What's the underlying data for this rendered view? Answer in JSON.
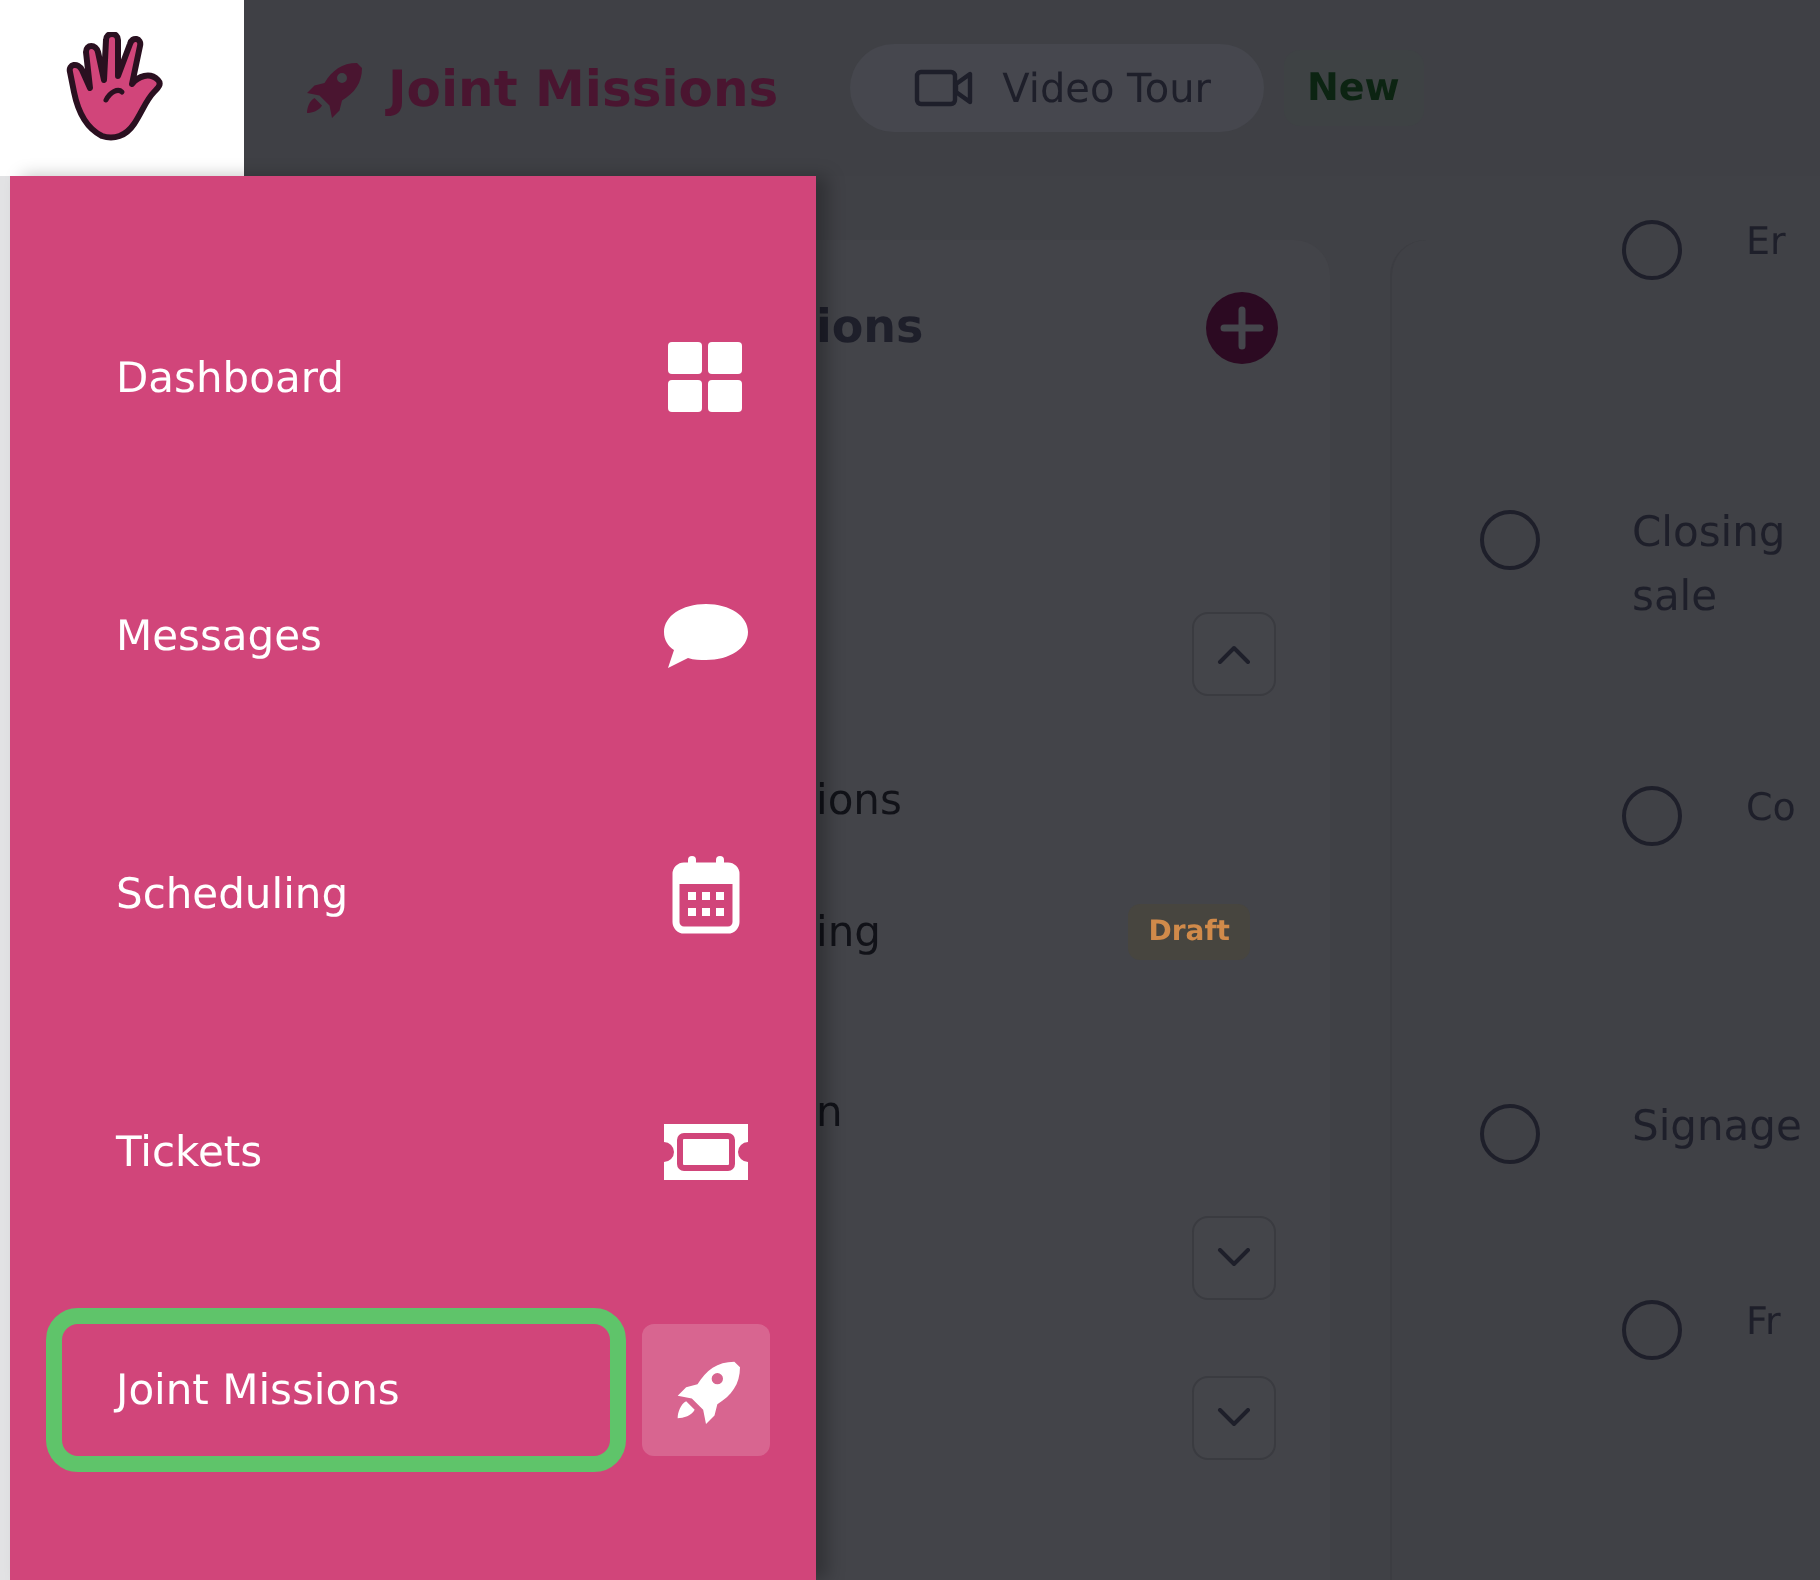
{
  "header": {
    "title": "Joint Missions",
    "video_button": "Video Tour",
    "badge": "New"
  },
  "sidebar": {
    "items": [
      {
        "label": "Dashboard",
        "selected": false,
        "highlighted": false
      },
      {
        "label": "Messages",
        "selected": false,
        "highlighted": false
      },
      {
        "label": "Scheduling",
        "selected": false,
        "highlighted": false
      },
      {
        "label": "Tickets",
        "selected": false,
        "highlighted": false
      },
      {
        "label": "Joint Missions",
        "selected": true,
        "highlighted": true
      }
    ]
  },
  "left_panel": {
    "title": "ions",
    "rows": [
      {
        "kind": "toggle",
        "expanded": true
      },
      {
        "kind": "text",
        "label": "ions"
      },
      {
        "kind": "text",
        "label": "ing",
        "badge": "Draft"
      },
      {
        "kind": "text",
        "label": "n"
      },
      {
        "kind": "toggle",
        "expanded": false
      },
      {
        "kind": "toggle",
        "expanded": false
      }
    ]
  },
  "right_panel": {
    "tasks": [
      {
        "label": "Er",
        "indented": true,
        "checked": false
      },
      {
        "label": "Closing sale",
        "indented": false,
        "checked": false
      },
      {
        "label": "Co",
        "indented": true,
        "checked": false
      },
      {
        "label": "Signage",
        "indented": false,
        "checked": false
      },
      {
        "label": "Fr",
        "indented": true,
        "checked": false
      }
    ]
  }
}
